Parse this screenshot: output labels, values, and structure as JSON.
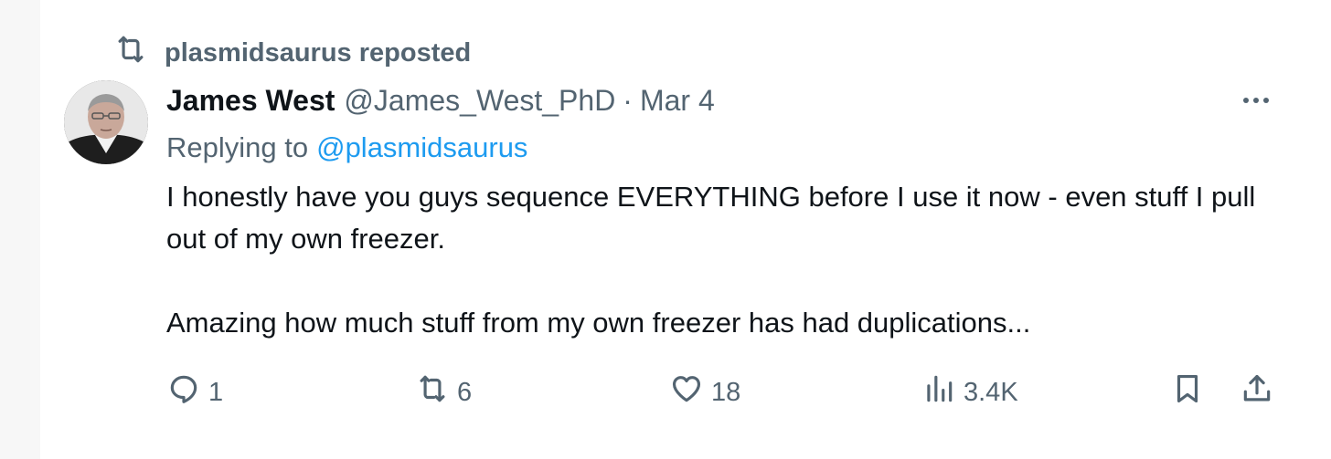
{
  "repost_banner": {
    "text": "plasmidsaurus reposted",
    "icon": "repost-icon"
  },
  "tweet": {
    "author_name": "James West",
    "author_handle": "@James_West_PhD",
    "separator": "·",
    "date": "Mar 4",
    "replying_prefix": "Replying to",
    "replying_to": "@plasmidsaurus",
    "text_paragraphs": [
      "I honestly have you guys sequence EVERYTHING before I use it now - even stuff I pull out of my own freezer.",
      "Amazing how much stuff from my own freezer has had duplications..."
    ]
  },
  "actions": {
    "reply_count": "1",
    "repost_count": "6",
    "like_count": "18",
    "views_count": "3.4K"
  },
  "colors": {
    "text_primary": "#0f1419",
    "text_secondary": "#536471",
    "link": "#1d9bf0",
    "background": "#ffffff",
    "page_background": "#f7f7f7"
  },
  "icons": [
    "repost-icon",
    "more-icon",
    "reply-icon",
    "like-icon",
    "views-icon",
    "bookmark-icon",
    "share-icon"
  ]
}
